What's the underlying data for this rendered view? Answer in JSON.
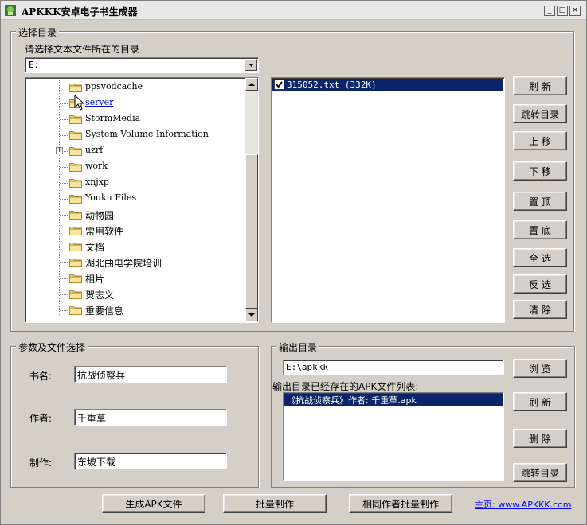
{
  "window": {
    "title": "APKKK安卓电子书生成器",
    "minimize": "_",
    "maximize": "□",
    "close": "×"
  },
  "select_dir_group": {
    "title": "选择目录",
    "prompt": "请选择文本文件所在的目录",
    "drive_value": "E:",
    "tree": [
      {
        "label": "ppsvodcache"
      },
      {
        "label": "server"
      },
      {
        "label": "StormMedia"
      },
      {
        "label": "System Volume Information"
      },
      {
        "label": "uzrf",
        "expander": "+"
      },
      {
        "label": "work"
      },
      {
        "label": "xnjxp"
      },
      {
        "label": "Youku Files"
      },
      {
        "label": "动物园"
      },
      {
        "label": "常用软件"
      },
      {
        "label": "文档"
      },
      {
        "label": "湖北曲电学院培训"
      },
      {
        "label": "相片"
      },
      {
        "label": "贺志义"
      },
      {
        "label": "重要信息"
      }
    ],
    "files": [
      {
        "label": "315052.txt (332K)",
        "checked": true,
        "selected": true
      }
    ],
    "buttons": {
      "refresh": "刷 新",
      "goto_dir": "跳转目录",
      "move_up": "上 移",
      "move_down": "下 移",
      "to_top": "置 顶",
      "to_bottom": "置 底",
      "select_all": "全 选",
      "invert": "反 选",
      "clear": "清 除"
    }
  },
  "params_group": {
    "title": "参数及文件选择",
    "book_label": "书名:",
    "book_value": "抗战侦察兵",
    "author_label": "作者:",
    "author_value": "千重草",
    "maker_label": "制作:",
    "maker_value": "东坡下载"
  },
  "output_group": {
    "title": "输出目录",
    "path_value": "E:\\apkkk",
    "browse": "浏 览",
    "list_label": "输出目录已经存在的APK文件列表:",
    "apk_files": [
      "《抗战侦察兵》作者: 千重草.apk"
    ],
    "refresh": "刷 新",
    "delete": "删 除",
    "goto_dir": "跳转目录"
  },
  "bottom": {
    "generate": "生成APK文件",
    "batch": "批量制作",
    "batch_same_author": "相同作者批量制作",
    "homepage": "主页: www.APKKK.com"
  },
  "colors": {
    "face": "#d4d0c8",
    "selection": "#0a246a",
    "link": "#0000ff"
  }
}
